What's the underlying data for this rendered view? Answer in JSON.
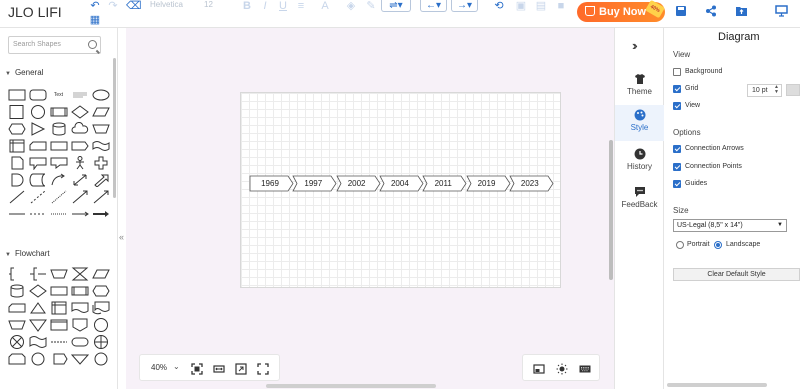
{
  "app": {
    "title": "JLO LIFI"
  },
  "toolbar": {
    "font": "Helvetica",
    "font_size": "12",
    "buy_label": "Buy Now",
    "buy_badge": "40%"
  },
  "left_panel": {
    "search_placeholder": "Search Shapes",
    "sections": {
      "general": "General",
      "flowchart": "Flowchart"
    },
    "text_shape_label": "Text"
  },
  "canvas": {
    "timeline": [
      "1969",
      "1997",
      "2002",
      "2004",
      "2011",
      "2019",
      "2023"
    ],
    "zoom": "40%"
  },
  "side_tabs": [
    {
      "label": "Theme",
      "icon": "shirt-icon"
    },
    {
      "label": "Style",
      "icon": "palette-icon"
    },
    {
      "label": "History",
      "icon": "clock-icon"
    },
    {
      "label": "FeedBack",
      "icon": "chat-icon"
    }
  ],
  "props": {
    "title": "Diagram",
    "view_heading": "View",
    "background_label": "Background",
    "grid_label": "Grid",
    "grid_size": "10 pt",
    "view_label": "View",
    "options_heading": "Options",
    "connection_arrows_label": "Connection Arrows",
    "connection_points_label": "Connection Points",
    "guides_label": "Guides",
    "size_heading": "Size",
    "size_value": "US-Legal (8,5\" x 14\")",
    "portrait_label": "Portrait",
    "landscape_label": "Landscape",
    "clear_style_label": "Clear Default Style"
  },
  "colors": {
    "accent": "#2b6fc9",
    "buy": "#ff7a2a",
    "canvas_bg": "#f7f1f8"
  }
}
